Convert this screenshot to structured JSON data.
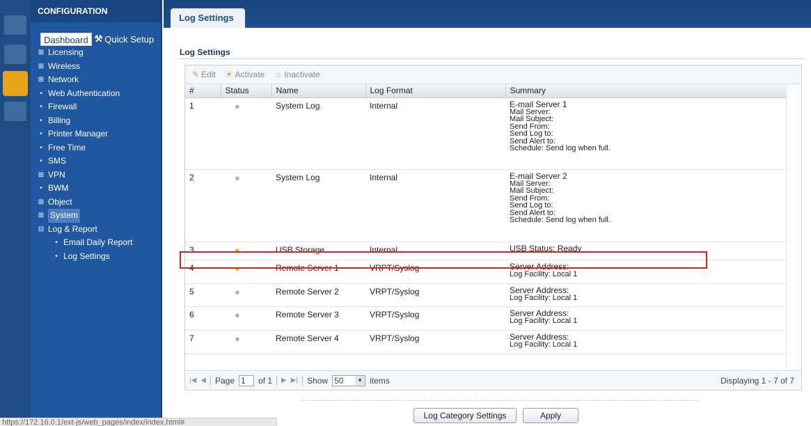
{
  "sidebar": {
    "header": "CONFIGURATION",
    "dashboard": "Dashboard",
    "quick_setup": "Quick Setup",
    "items": [
      {
        "marker": "⊞",
        "label": "Licensing",
        "sub": false
      },
      {
        "marker": "⊞",
        "label": "Wireless",
        "sub": false
      },
      {
        "marker": "⊞",
        "label": "Network",
        "sub": false
      },
      {
        "marker": "•",
        "label": "Web Authentication",
        "sub": false
      },
      {
        "marker": "•",
        "label": "Firewall",
        "sub": false
      },
      {
        "marker": "•",
        "label": "Billing",
        "sub": false
      },
      {
        "marker": "•",
        "label": "Printer Manager",
        "sub": false
      },
      {
        "marker": "•",
        "label": "Free Time",
        "sub": false
      },
      {
        "marker": "•",
        "label": "SMS",
        "sub": false
      },
      {
        "marker": "⊞",
        "label": "VPN",
        "sub": false
      },
      {
        "marker": "•",
        "label": "BWM",
        "sub": false
      },
      {
        "marker": "⊞",
        "label": "Object",
        "sub": false
      },
      {
        "marker": "⊞",
        "label": "System",
        "sub": false
      },
      {
        "marker": "⊟",
        "label": "Log & Report",
        "sub": false
      },
      {
        "marker": "•",
        "label": "Email Daily Report",
        "sub": true
      },
      {
        "marker": "•",
        "label": "Log Settings",
        "sub": true
      }
    ]
  },
  "tab": {
    "label": "Log Settings"
  },
  "main": {
    "title": "Log Settings"
  },
  "toolbar": {
    "edit": "Edit",
    "activate": "Activate",
    "inactivate": "Inactivate"
  },
  "table": {
    "headers": [
      "#",
      "Status",
      "Name",
      "Log Format",
      "Summary"
    ],
    "rows": [
      {
        "num": "1",
        "active": false,
        "name": "System Log",
        "format": "Internal",
        "summary": [
          "E-mail Server 1",
          "Mail Server:",
          "Mail Subject:",
          "Send From:",
          "Send Log to:",
          "Send Alert to:",
          "Schedule: Send log when full."
        ]
      },
      {
        "num": "2",
        "active": false,
        "name": "System Log",
        "format": "Internal",
        "summary": [
          "E-mail Server 2",
          "Mail Server:",
          "Mail Subject:",
          "Send From:",
          "Send Log to:",
          "Send Alert to:",
          "Schedule: Send log when full."
        ]
      },
      {
        "num": "3",
        "active": true,
        "name": "USB Storage",
        "format": "Internal",
        "summary": [
          "USB Status: Ready"
        ]
      },
      {
        "num": "4",
        "active": true,
        "name": "Remote Server 1",
        "format": "VRPT/Syslog",
        "summary": [
          "Server Address:",
          "Log Facility: Local 1"
        ]
      },
      {
        "num": "5",
        "active": false,
        "name": "Remote Server 2",
        "format": "VRPT/Syslog",
        "summary": [
          "Server Address:",
          "Log Facility: Local 1"
        ]
      },
      {
        "num": "6",
        "active": false,
        "name": "Remote Server 3",
        "format": "VRPT/Syslog",
        "summary": [
          "Server Address:",
          "Log Facility: Local 1"
        ]
      },
      {
        "num": "7",
        "active": false,
        "name": "Remote Server 4",
        "format": "VRPT/Syslog",
        "summary": [
          "Server Address:",
          "Log Facility: Local 1"
        ]
      }
    ]
  },
  "pager": {
    "page_label": "Page",
    "page_value": "1",
    "of_label": "of 1",
    "show_label": "Show",
    "show_value": "50",
    "items_label": "items",
    "display": "Displaying 1 - 7 of 7"
  },
  "buttons": {
    "log_category": "Log Category Settings",
    "apply": "Apply"
  },
  "status_url": "https://172.16.0.1/ext-js/web_pages/index/index.html#"
}
